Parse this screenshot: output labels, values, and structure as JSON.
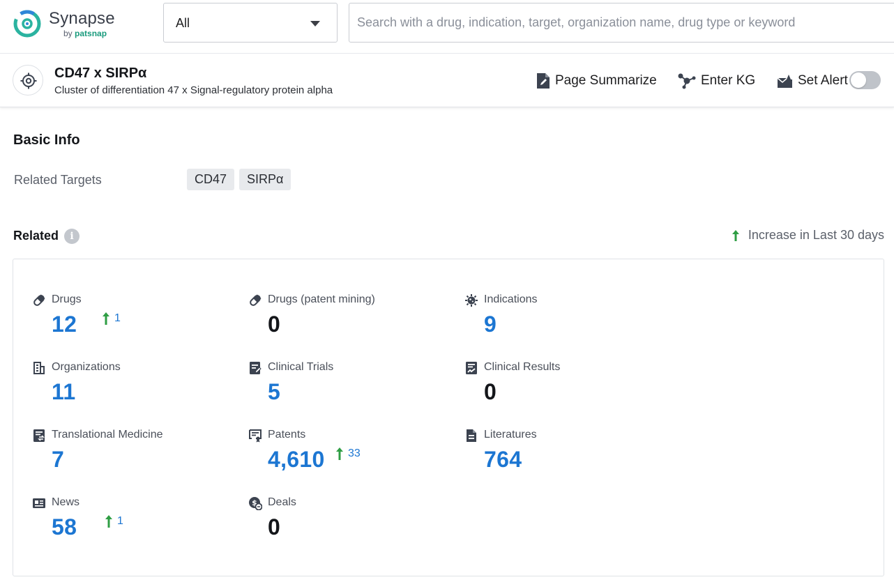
{
  "header": {
    "brand_name": "Synapse",
    "brand_by": "by",
    "brand_company": "patsnap",
    "scope_value": "All",
    "search_placeholder": "Search with a drug, indication, target, organization name, drug type or keyword"
  },
  "entity": {
    "title": "CD47 x SIRPα",
    "subtitle": "Cluster of differentiation 47 x Signal-regulatory protein alpha",
    "actions": {
      "summarize": "Page Summarize",
      "kg": "Enter KG",
      "alert": "Set Alert"
    },
    "alert_enabled": false
  },
  "basic_info": {
    "title": "Basic Info",
    "related_targets_label": "Related Targets",
    "targets": [
      "CD47",
      "SIRPα"
    ]
  },
  "related": {
    "title": "Related",
    "legend": "Increase in Last 30 days",
    "stats": [
      {
        "label": "Drugs",
        "value": "12",
        "increase": "1",
        "icon": "pill-icon"
      },
      {
        "label": "Drugs (patent mining)",
        "value": "0",
        "icon": "pill-icon"
      },
      {
        "label": "Indications",
        "value": "9",
        "icon": "virus-icon"
      },
      {
        "label": "Organizations",
        "value": "11",
        "icon": "building-icon"
      },
      {
        "label": "Clinical Trials",
        "value": "5",
        "icon": "clipboard-edit-icon"
      },
      {
        "label": "Clinical Results",
        "value": "0",
        "icon": "chart-document-icon"
      },
      {
        "label": "Translational Medicine",
        "value": "7",
        "icon": "document-transfer-icon"
      },
      {
        "label": "Patents",
        "value": "4,610",
        "increase": "33",
        "icon": "certificate-icon"
      },
      {
        "label": "Literatures",
        "value": "764",
        "icon": "file-text-icon"
      },
      {
        "label": "News",
        "value": "58",
        "increase": "1",
        "icon": "newspaper-icon"
      },
      {
        "label": "Deals",
        "value": "0",
        "icon": "coin-icon"
      }
    ]
  },
  "colors": {
    "accent_blue": "#1c76d2",
    "increase_green": "#2f9e44",
    "brand_teal": "#1a9b7d"
  }
}
